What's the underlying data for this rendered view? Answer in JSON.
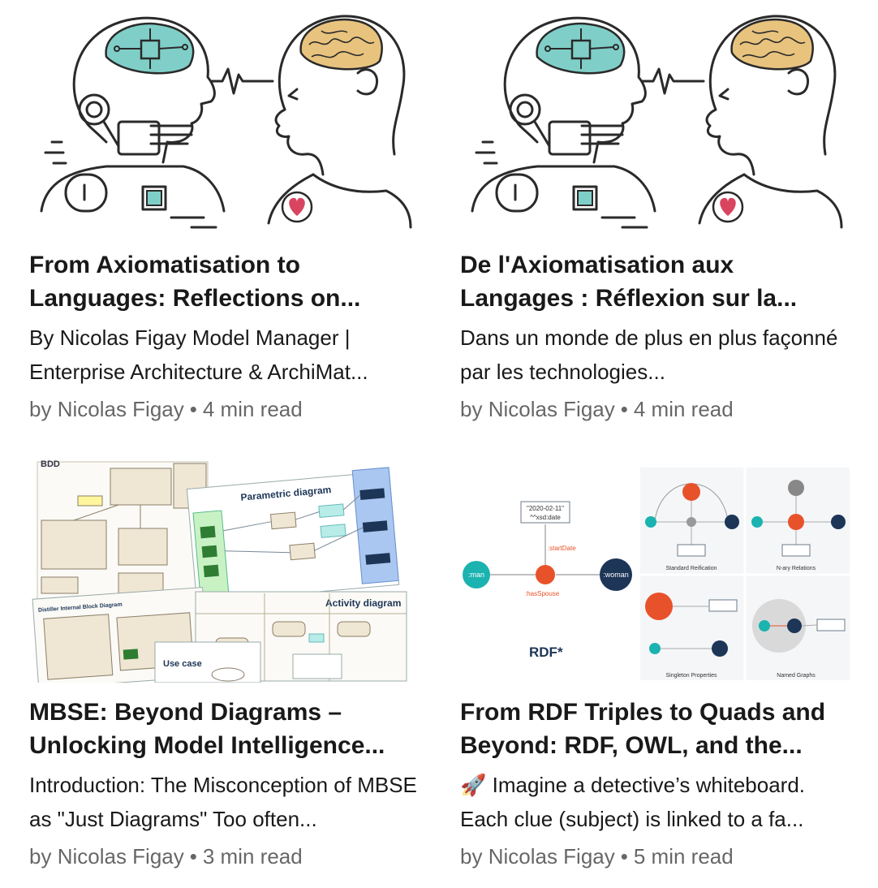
{
  "articles": [
    {
      "image": "ai-human-brain-illustration",
      "title": "From Axiomatisation to Languages: Reflections on...",
      "description": "By Nicolas Figay Model Manager | Enterprise Architecture & ArchiMat...",
      "by_prefix": "by",
      "author": "Nicolas Figay",
      "separator": "•",
      "read_time": "4 min read"
    },
    {
      "image": "ai-human-brain-illustration",
      "title": "De l'Axiomatisation aux Langages : Réflexion sur la...",
      "description": "Dans un monde de plus en plus façonné par les technologies...",
      "by_prefix": "by",
      "author": "Nicolas Figay",
      "separator": "•",
      "read_time": "4 min read"
    },
    {
      "image": "sysml-diagrams-collage",
      "title": "MBSE: Beyond Diagrams – Unlocking Model Intelligence...",
      "description": "Introduction: The Misconception of MBSE as \"Just Diagrams\" Too often...",
      "by_prefix": "by",
      "author": "Nicolas Figay",
      "separator": "•",
      "read_time": "3 min read"
    },
    {
      "image": "rdf-reification-diagrams",
      "title": "From RDF Triples to Quads and Beyond: RDF, OWL, and the...",
      "description": "🚀 Imagine a detective’s whiteboard. Each clue (subject) is linked to a fa...",
      "by_prefix": "by",
      "author": "Nicolas Figay",
      "separator": "•",
      "read_time": "5 min read"
    }
  ],
  "thumbnails": {
    "mbse": {
      "bdd": "BDD",
      "parametric": "Parametric diagram",
      "activity": "Activity diagram",
      "usecase": "Use case",
      "ibd": "Distiller Internal Block Diagram"
    },
    "rdf": {
      "main_title": "RDF*",
      "date_literal": "\"2020-02-11\"",
      "date_type": "^^xsd:date",
      "start_date": ":startDate",
      "man": ":man",
      "woman": ":woman",
      "has_spouse": ":hasSpouse",
      "standard_reification": "Standard Reification",
      "nary_relations": "N-ary Relations",
      "singleton_properties": "Singleton Properties",
      "named_graphs": "Named Graphs"
    }
  },
  "colors": {
    "rdf_orange": "#e8522a",
    "rdf_teal": "#1bb3b0",
    "rdf_navy": "#1d3557",
    "brain_teal": "#7fcfc8",
    "brain_tan": "#e8c37e",
    "heart_red": "#d9455f"
  }
}
